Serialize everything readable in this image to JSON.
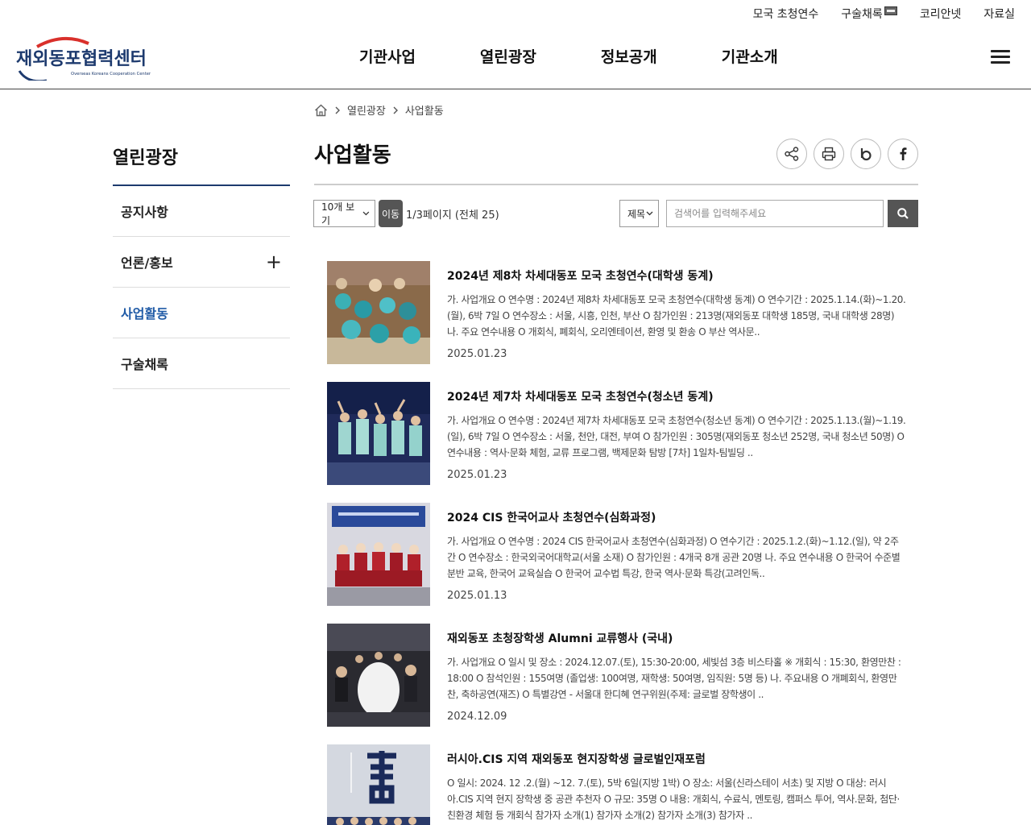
{
  "utility": {
    "items": [
      "모국 초청연수",
      "구술채록",
      "코리안넷",
      "자료실"
    ]
  },
  "logo": {
    "korean": "재외동포협력센터",
    "english": "Overseas Koreans Cooperation Center"
  },
  "gnb": {
    "items": [
      "기관사업",
      "열린광장",
      "정보공개",
      "기관소개"
    ]
  },
  "breadcrumb": {
    "items": [
      "열린광장",
      "사업활동"
    ]
  },
  "lnb": {
    "title": "열린광장",
    "items": [
      "공지사항",
      "언론/홍보",
      "사업활동",
      "구술채록"
    ],
    "expand_symbol": "+"
  },
  "content": {
    "title": "사업활동"
  },
  "controls": {
    "page_size": "10개 보기",
    "go_label": "이동",
    "page_info": "1/3페이지 (전체 25)",
    "search_field": "제목",
    "search_placeholder": "검색어를 입력해주세요"
  },
  "posts": [
    {
      "title": "2024년 제8차 차세대동포 모국 초청연수(대학생 동계)",
      "desc": "가. 사업개요 O 연수명 : 2024년 제8차 차세대동포 모국 초청연수(대학생 동계) O 연수기간 : 2025.1.14.(화)~1.20.(월), 6박 7일 O 연수장소 : 서울, 시흥, 인천, 부산 O 참가인원 : 213명(재외동포 대학생 185명, 국내 대학생 28명) 나. 주요 연수내용 O 개회식, 폐회식, 오리엔테이션, 환영 및 환송 O 부산 역사문..",
      "date": "2025.01.23"
    },
    {
      "title": "2024년 제7차 차세대동포 모국 초청연수(청소년 동계)",
      "desc": "가. 사업개요 O 연수명 : 2024년 제7차 차세대동포 모국 초청연수(청소년 동계) O 연수기간 : 2025.1.13.(월)~1.19.(일), 6박 7일 O 연수장소 : 서울, 천안, 대전, 부여 O 참가인원 : 305명(재외동포 청소년 252명, 국내 청소년 50명) O 연수내용 : 역사·문화 체험, 교류 프로그램, 백제문화 탐방 [7차] 1일차-팀빌딩 ..",
      "date": "2025.01.23"
    },
    {
      "title": "2024 CIS 한국어교사 초청연수(심화과정)",
      "desc": "가. 사업개요 O 연수명 : 2024 CIS 한국어교사 초청연수(심화과정) O 연수기간 : 2025.1.2.(화)~1.12.(일), 약 2주간 O 연수장소 : 한국외국어대학교(서울 소재) O 참가인원 : 4개국 8개 공관 20명 나. 주요 연수내용 O 한국어 수준별 분반 교육, 한국어 교육실습 O 한국어 교수법 특강, 한국 역사·문화 특강(고려인독..",
      "date": "2025.01.13"
    },
    {
      "title": "재외동포 초청장학생 Alumni 교류행사 (국내)",
      "desc": "가. 사업개요 O 일시 및 장소 : 2024.12.07.(토), 15:30-20:00, 세빛섬 3층 비스타홀 ※ 개회식 : 15:30, 환영만찬 : 18:00 O 참석인원 : 155여명 (졸업생: 100여명, 재학생: 50여명, 임직원: 5명 등) 나. 주요내용 O 개폐회식, 환영만찬, 축하공연(재즈) O 특별강연 - 서울대 한디혜 연구위원(주제: 글로벌 장학생이 ..",
      "date": "2024.12.09"
    },
    {
      "title": "러시아.CIS 지역 재외동포 현지장학생 글로벌인재포럼",
      "desc": "O 일시: 2024. 12 .2.(월) ~12. 7.(토), 5박 6일(지방 1박) O 장소: 서울(신라스테이 서초) 및 지방 O 대상: 러시아.CIS 지역 현지 장학생 중 공관 추천자 O 규모: 35명 O 내용: 개회식, 수료식, 멘토링, 캠퍼스 투어, 역사.문화, 첨단·친환경 체험 등 개회식 참가자 소개(1) 참가자 소개(2) 참가자 소개(3) 참가자 ..",
      "date": ""
    }
  ],
  "colors": {
    "brand_navy": "#1d3a6e",
    "brand_red": "#d9302b",
    "active_link": "#1f5aa6",
    "button_gray": "#555555"
  },
  "icons": [
    "home-icon",
    "share-icon",
    "print-icon",
    "blog-icon",
    "facebook-icon",
    "search-icon",
    "menu-icon",
    "plus-icon",
    "chevron-right-icon",
    "chevron-down-icon"
  ]
}
